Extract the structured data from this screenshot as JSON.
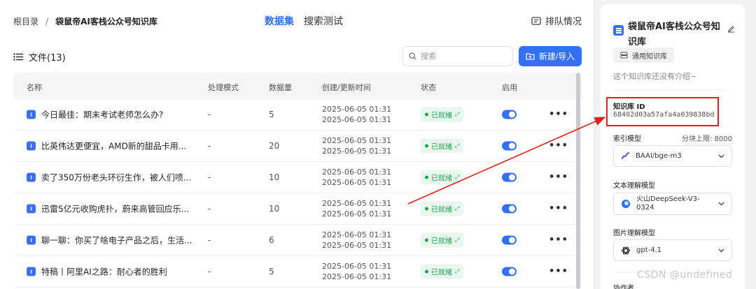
{
  "breadcrumb": {
    "root": "根目录",
    "separator": "/",
    "current": "袋鼠帝AI客栈公众号知识库"
  },
  "tabs": [
    {
      "label": "数据集",
      "active": true
    },
    {
      "label": "搜索测试",
      "active": false
    }
  ],
  "queue_label": "排队情况",
  "files_title": "文件(13)",
  "search": {
    "placeholder": "搜索"
  },
  "new_button": "新建/导入",
  "table": {
    "headers": {
      "name": "名称",
      "mode": "处理模式",
      "count": "数据量",
      "time": "创建/更新时间",
      "status": "状态",
      "enabled": "启用"
    },
    "rows": [
      {
        "title": "今日最佳：期末考试老师怎么办?",
        "mode": "-",
        "count": "5",
        "created": "2025-06-05 01:31",
        "updated": "2025-06-05 01:31",
        "status": "已就绪",
        "enabled": true
      },
      {
        "title": "比英伟达更便宜，AMD新的甜品卡用...",
        "mode": "-",
        "count": "20",
        "created": "2025-06-05 01:31",
        "updated": "2025-06-05 01:31",
        "status": "已就绪",
        "enabled": true
      },
      {
        "title": "卖了350万份老头环衍生作，被人们喷...",
        "mode": "-",
        "count": "10",
        "created": "2025-06-05 01:31",
        "updated": "2025-06-05 01:31",
        "status": "已就绪",
        "enabled": true
      },
      {
        "title": "迅雷5亿元收购虎扑，蔚来高管回应乐...",
        "mode": "-",
        "count": "10",
        "created": "2025-06-05 01:31",
        "updated": "2025-06-05 01:31",
        "status": "已就绪",
        "enabled": true
      },
      {
        "title": "聊一聊：你买了啥电子产品之后，生活...",
        "mode": "-",
        "count": "6",
        "created": "2025-06-05 01:31",
        "updated": "2025-06-05 01:31",
        "status": "已就绪",
        "enabled": true
      },
      {
        "title": "特稿丨阿里AI之路：耐心者的胜利",
        "mode": "-",
        "count": "5",
        "created": "2025-06-05 01:31",
        "updated": "2025-06-05 01:31",
        "status": "已就绪",
        "enabled": true
      }
    ]
  },
  "sidebar": {
    "kb_name": "袋鼠帝AI客栈公众号知识库",
    "kb_type": "通用知识库",
    "kb_desc": "这个知识库还没有介绍~",
    "kb_id_label": "知识库 ID",
    "kb_id": "68402d03a57afa4a039838bd",
    "index_model_label": "索引模型",
    "chunk_limit": "分块上限: 8000",
    "index_model": "BAAI/bge-m3",
    "text_model_label": "文本理解模型",
    "text_model": "火山DeepSeek-V3-0324",
    "image_model_label": "图片理解模型",
    "image_model": "gpt-4.1",
    "collaborators_label": "协作者"
  },
  "watermark": "CSDN @undefined",
  "colors": {
    "accent": "#3370ff",
    "status_green": "#23a35a",
    "annotation_red": "#e0201b"
  }
}
